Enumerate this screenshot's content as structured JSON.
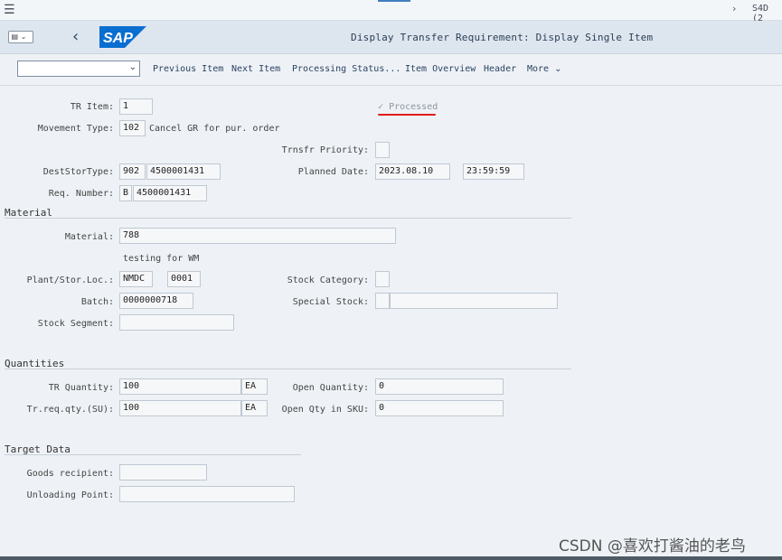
{
  "system": {
    "id": "S4D (2"
  },
  "window": {
    "title": "Display Transfer Requirement: Display Single Item",
    "logo_text": "SAP"
  },
  "toolbar": {
    "items": [
      "Previous Item",
      "Next Item",
      "Processing Status...",
      "Item Overview",
      "Header",
      "More"
    ]
  },
  "header": {
    "tr_item_label": "TR Item:",
    "tr_item": "1",
    "processed_label": "Processed",
    "movement_type_label": "Movement Type:",
    "movement_type": "102",
    "movement_type_text": "Cancel GR for pur. order",
    "priority_label": "Trnsfr Priority:",
    "priority": "",
    "dest_label": "DestStorType:",
    "dest_type": "902",
    "dest_bin": "4500001431",
    "planned_label": "Planned Date:",
    "planned_date": "2023.08.10",
    "planned_time": "23:59:59",
    "req_label": "Req. Number:",
    "req_type": "B",
    "req_number": "4500001431"
  },
  "material": {
    "section": "Material",
    "material_label": "Material:",
    "material": "788",
    "description": "testing for WM",
    "plant_label": "Plant/Stor.Loc.:",
    "plant": "NMDC",
    "stor_loc": "0001",
    "stock_cat_label": "Stock Category:",
    "stock_cat": "",
    "batch_label": "Batch:",
    "batch": "0000000718",
    "special_label": "Special Stock:",
    "special_1": "",
    "special_2": "",
    "segment_label": "Stock Segment:",
    "segment": ""
  },
  "quantities": {
    "section": "Quantities",
    "tr_qty_label": "TR Quantity:",
    "tr_qty": "100",
    "tr_unit": "EA",
    "open_qty_label": "Open Quantity:",
    "open_qty": "0",
    "req_qty_label": "Tr.req.qty.(SU):",
    "req_qty": "100",
    "req_unit": "EA",
    "open_sku_label": "Open Qty in SKU:",
    "open_sku": "0"
  },
  "target": {
    "section": "Target Data",
    "recipient_label": "Goods recipient:",
    "recipient": "",
    "unloading_label": "Unloading Point:",
    "unloading": ""
  },
  "watermark": "CSDN @喜欢打酱油的老鸟",
  "colors": {
    "accent": "#3f7fbf",
    "sap_blue": "#0a6ed1",
    "annotation_red": "#e31b1b"
  }
}
